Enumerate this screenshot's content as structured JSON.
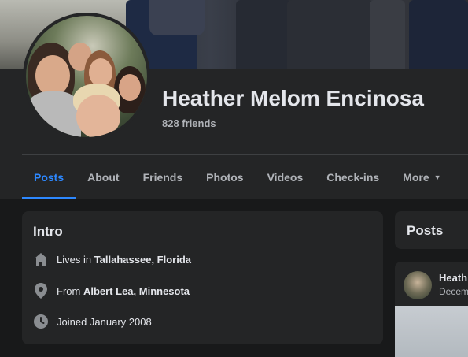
{
  "profile": {
    "name": "Heather Melom Encinosa",
    "friends": "828 friends"
  },
  "tabs": [
    {
      "label": "Posts",
      "active": true
    },
    {
      "label": "About"
    },
    {
      "label": "Friends"
    },
    {
      "label": "Photos"
    },
    {
      "label": "Videos"
    },
    {
      "label": "Check-ins"
    },
    {
      "label": "More"
    }
  ],
  "intro": {
    "title": "Intro",
    "lives_prefix": "Lives in ",
    "lives_place": "Tallahassee, Florida",
    "from_prefix": "From ",
    "from_place": "Albert Lea, Minnesota",
    "joined": "Joined January 2008"
  },
  "posts": {
    "title": "Posts",
    "author": "Heath",
    "date": "Decem"
  },
  "colors": {
    "accent": "#2d88ff",
    "background": "#18191a",
    "card": "#242526",
    "secondary_text": "#b0b3b8"
  },
  "icons": [
    "home-icon",
    "location-pin-icon",
    "clock-icon",
    "caret-down-icon"
  ]
}
